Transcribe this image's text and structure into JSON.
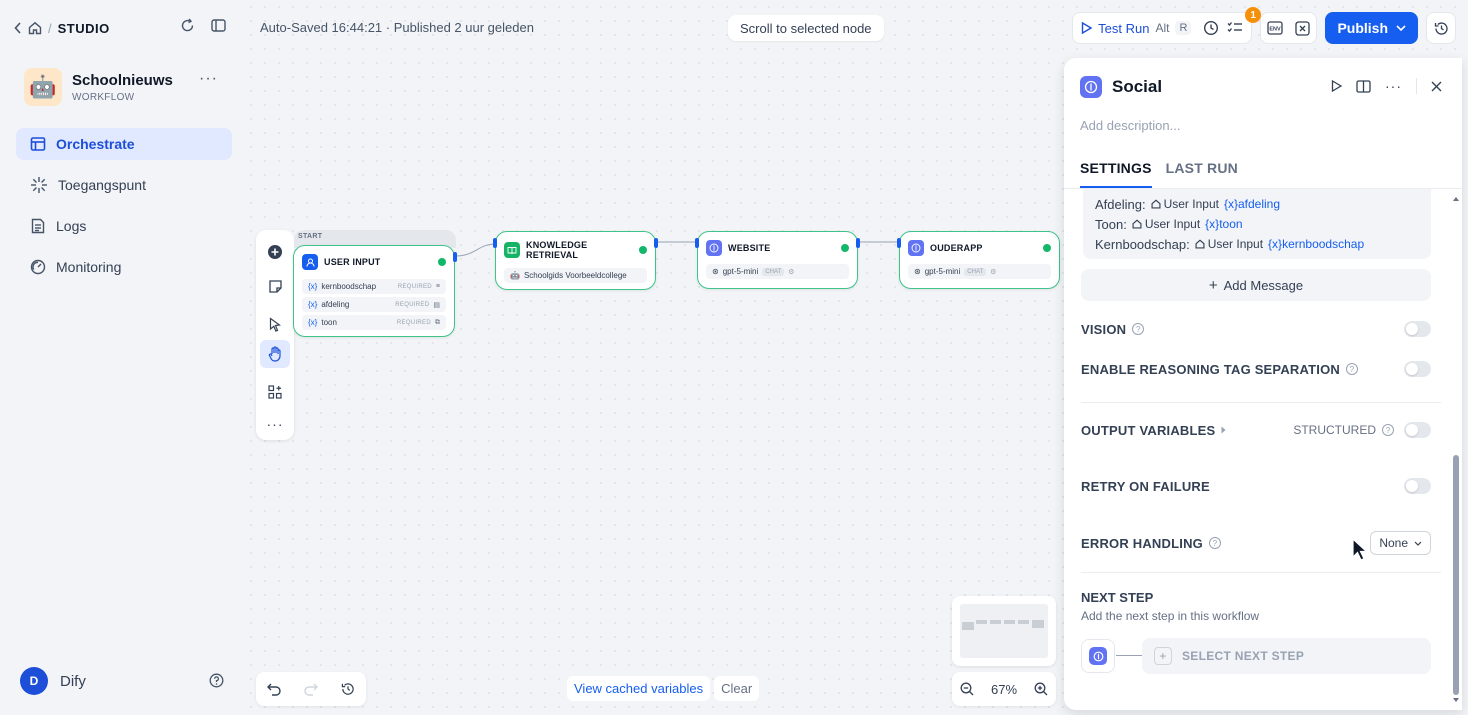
{
  "breadcrumb": {
    "section": "STUDIO"
  },
  "app": {
    "name": "Schoolnieuws",
    "kind": "WORKFLOW",
    "emoji": "🤖"
  },
  "nav": [
    {
      "label": "Orchestrate",
      "icon": "orchestrate-icon",
      "active": true
    },
    {
      "label": "Toegangspunt",
      "icon": "access-point-icon",
      "active": false
    },
    {
      "label": "Logs",
      "icon": "logs-icon",
      "active": false
    },
    {
      "label": "Monitoring",
      "icon": "monitoring-icon",
      "active": false
    }
  ],
  "user": {
    "initial": "D",
    "name": "Dify"
  },
  "topbar": {
    "status": "Auto-Saved 16:44:21 · Published 2 uur geleden",
    "scroll_to_node": "Scroll to selected node",
    "test_run": "Test Run",
    "shortcut_alt": "Alt",
    "shortcut_key": "R",
    "checklist_badge": "1",
    "env_label": "ENV",
    "publish": "Publish"
  },
  "nodes": {
    "start_label": "START",
    "user_input": {
      "title": "USER INPUT",
      "vars": [
        {
          "name": "kernboodschap",
          "req": "REQUIRED"
        },
        {
          "name": "afdeling",
          "req": "REQUIRED"
        },
        {
          "name": "toon",
          "req": "REQUIRED"
        }
      ],
      "var_prefix": "{x}"
    },
    "knowledge": {
      "title": "KNOWLEDGE RETRIEVAL",
      "source": "Schoolgids Voorbeeldcollege"
    },
    "website": {
      "title": "WEBSITE",
      "model": "gpt-5-mini",
      "chip": "CHAT"
    },
    "ouderapp": {
      "title": "OUDERAPP",
      "model": "gpt-5-mini",
      "chip": "CHAT"
    }
  },
  "bottom": {
    "view_cached": "View cached variables",
    "clear": "Clear",
    "zoom": "67%"
  },
  "panel": {
    "title": "Social",
    "description_placeholder": "Add description...",
    "tabs": [
      "SETTINGS",
      "LAST RUN"
    ],
    "variables": [
      {
        "label": "Afdeling:",
        "source": "User Input",
        "var": "{x}afdeling"
      },
      {
        "label": "Toon:",
        "source": "User Input",
        "var": "{x}toon"
      },
      {
        "label": "Kernboodschap:",
        "source": "User Input",
        "var": "{x}kernboodschap"
      }
    ],
    "add_message": "Add Message",
    "vision": "VISION",
    "reasoning": "ENABLE REASONING TAG SEPARATION",
    "output_variables": "OUTPUT VARIABLES",
    "structured": "STRUCTURED",
    "retry": "RETRY ON FAILURE",
    "error_handling": "ERROR HANDLING",
    "error_value": "None",
    "next_step_title": "NEXT STEP",
    "next_step_desc": "Add the next step in this workflow",
    "select_next": "SELECT NEXT STEP"
  },
  "colors": {
    "accent": "#155eef",
    "node_border": "#3ec48a",
    "llm_icon": "#6172f3"
  }
}
